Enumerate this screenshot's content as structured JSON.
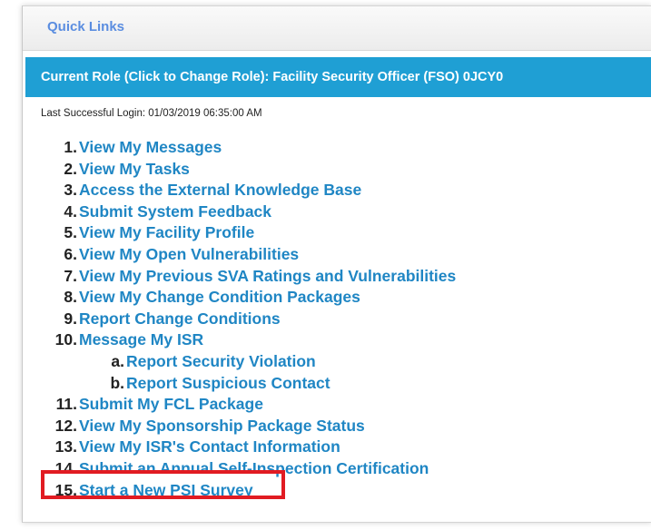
{
  "header": {
    "quick_links": "Quick Links"
  },
  "role_bar": {
    "label": "Current Role (Click to Change Role): Facility Security Officer (FSO) 0JCY0"
  },
  "last_login": "Last Successful Login: 01/03/2019 06:35:00 AM",
  "links": [
    {
      "num": "1.",
      "label": "View My Messages"
    },
    {
      "num": "2.",
      "label": "View My Tasks"
    },
    {
      "num": "3.",
      "label": "Access the External Knowledge Base"
    },
    {
      "num": "4.",
      "label": "Submit System Feedback"
    },
    {
      "num": "5.",
      "label": "View My Facility Profile"
    },
    {
      "num": "6.",
      "label": "View My Open Vulnerabilities"
    },
    {
      "num": "7.",
      "label": "View My Previous SVA Ratings and Vulnerabilities"
    },
    {
      "num": "8.",
      "label": "View My Change Condition Packages"
    },
    {
      "num": "9.",
      "label": "Report Change Conditions"
    },
    {
      "num": "10.",
      "label": "Message My ISR"
    },
    {
      "num": "a.",
      "label": "Report Security Violation"
    },
    {
      "num": "b.",
      "label": "Report Suspicious Contact"
    },
    {
      "num": "11.",
      "label": "Submit My FCL Package"
    },
    {
      "num": "12.",
      "label": "View My Sponsorship Package Status"
    },
    {
      "num": "13.",
      "label": "View My ISR's Contact Information"
    },
    {
      "num": "14.",
      "label": "Submit an Annual Self-Inspection Certification"
    },
    {
      "num": "15.",
      "label": "Start a New PSI Survey"
    }
  ],
  "colors": {
    "role_bar": "#1f9fd4",
    "link": "#1f86c4",
    "highlight": "#e11b22"
  }
}
